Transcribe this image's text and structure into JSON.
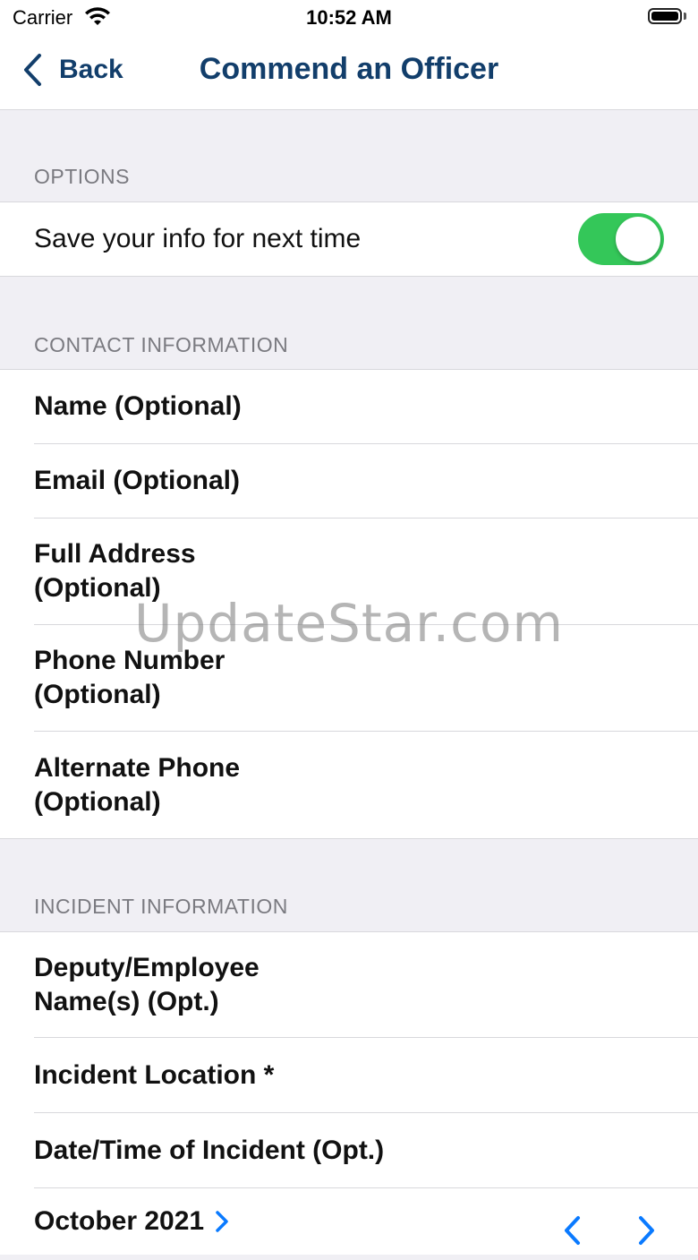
{
  "status_bar": {
    "carrier": "Carrier",
    "time": "10:52 AM",
    "icons": [
      "wifi-icon",
      "battery-icon"
    ]
  },
  "nav": {
    "back_label": "Back",
    "title": "Commend an Officer"
  },
  "options": {
    "header": "OPTIONS",
    "save_info_label": "Save your info for next time",
    "save_info_enabled": true
  },
  "contact": {
    "header": "CONTACT INFORMATION",
    "fields": [
      {
        "label": "Name (Optional)"
      },
      {
        "label": "Email (Optional)"
      },
      {
        "label_line1": "Full Address",
        "label_line2": "(Optional)"
      },
      {
        "label_line1": "Phone Number",
        "label_line2": "(Optional)"
      },
      {
        "label_line1": "Alternate Phone",
        "label_line2": "(Optional)"
      }
    ]
  },
  "incident": {
    "header": "INCIDENT INFORMATION",
    "deputy_line1": "Deputy/Employee",
    "deputy_line2": "Name(s) (Opt.)",
    "location_label": "Incident Location *",
    "datetime_label": "Date/Time of Incident (Opt.)",
    "month_label": "October 2021"
  },
  "watermark": "UpdateStar.com",
  "colors": {
    "accent": "#123e6b",
    "toggle_on": "#34c759",
    "link_blue": "#0a7aff",
    "background": "#f0eff4"
  }
}
